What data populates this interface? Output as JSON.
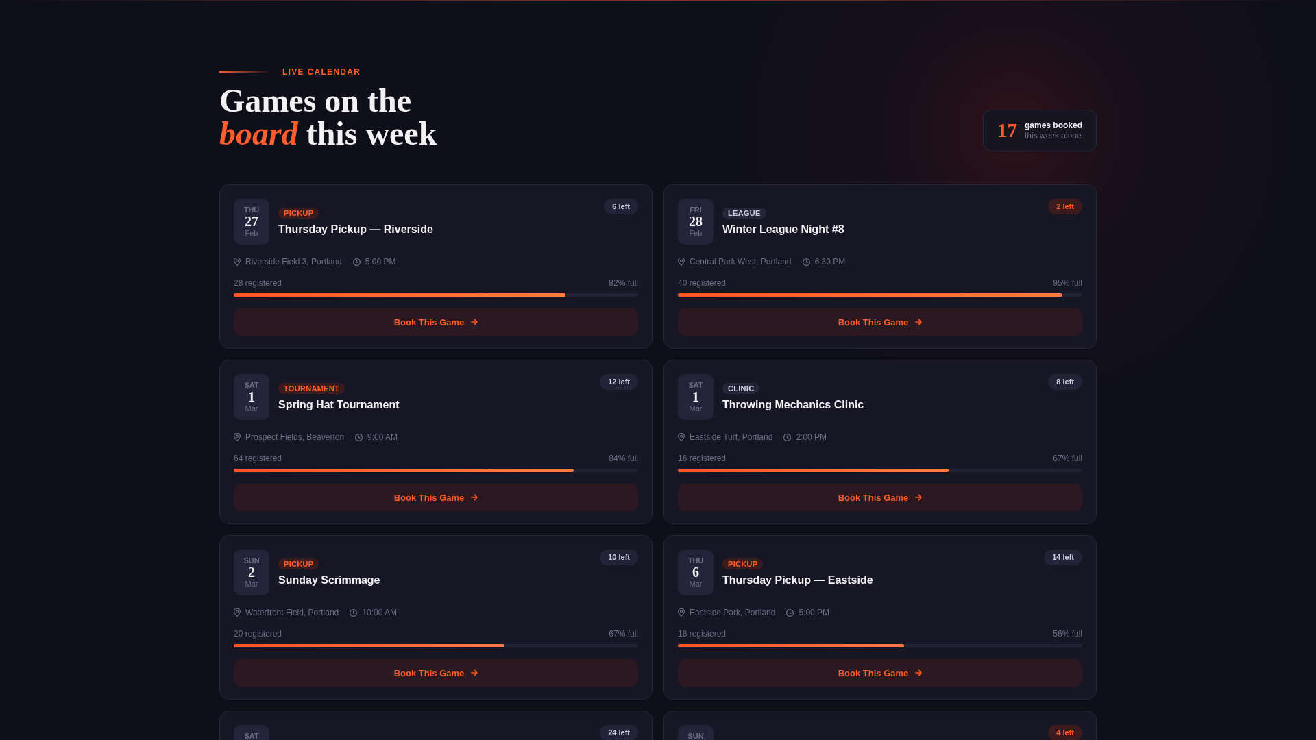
{
  "header": {
    "eyebrow": "LIVE CALENDAR",
    "heading": "Games on the *board* this week"
  },
  "stat": {
    "count": "17",
    "label": "games booked",
    "sublabel": "this week alone"
  },
  "games": [
    {
      "date": {
        "weekday": "THU",
        "day": "27",
        "month": "Feb"
      },
      "tag": {
        "label": "PICKUP",
        "kind": "accent"
      },
      "title": "Thursday Pickup — Riverside",
      "spots": {
        "label": "6 left",
        "urgent": false
      },
      "location": "Riverside Field 3, Portland",
      "time": "5:00 PM",
      "registered": "28 registered",
      "fill_label": "82% full",
      "level": 0.82,
      "action": "Book This Game"
    },
    {
      "date": {
        "weekday": "FRI",
        "day": "28",
        "month": "Feb"
      },
      "tag": {
        "label": "LEAGUE",
        "kind": "neutral"
      },
      "title": "Winter League Night #8",
      "spots": {
        "label": "2 left",
        "urgent": true
      },
      "location": "Central Park West, Portland",
      "time": "6:30 PM",
      "registered": "40 registered",
      "fill_label": "95% full",
      "level": 0.95,
      "action": "Book This Game"
    },
    {
      "date": {
        "weekday": "SAT",
        "day": "1",
        "month": "Mar"
      },
      "tag": {
        "label": "TOURNAMENT",
        "kind": "accent"
      },
      "title": "Spring Hat Tournament",
      "spots": {
        "label": "12 left",
        "urgent": false
      },
      "location": "Prospect Fields, Beaverton",
      "time": "9:00 AM",
      "registered": "64 registered",
      "fill_label": "84% full",
      "level": 0.84,
      "action": "Book This Game"
    },
    {
      "date": {
        "weekday": "SAT",
        "day": "1",
        "month": "Mar"
      },
      "tag": {
        "label": "CLINIC",
        "kind": "neutral"
      },
      "title": "Throwing Mechanics Clinic",
      "spots": {
        "label": "8 left",
        "urgent": false
      },
      "location": "Eastside Turf, Portland",
      "time": "2:00 PM",
      "registered": "16 registered",
      "fill_label": "67% full",
      "level": 0.67,
      "action": "Book This Game"
    },
    {
      "date": {
        "weekday": "SUN",
        "day": "2",
        "month": "Mar"
      },
      "tag": {
        "label": "PICKUP",
        "kind": "accent"
      },
      "title": "Sunday Scrimmage",
      "spots": {
        "label": "10 left",
        "urgent": false
      },
      "location": "Waterfront Field, Portland",
      "time": "10:00 AM",
      "registered": "20 registered",
      "fill_label": "67% full",
      "level": 0.67,
      "action": "Book This Game"
    },
    {
      "date": {
        "weekday": "THU",
        "day": "6",
        "month": "Mar"
      },
      "tag": {
        "label": "PICKUP",
        "kind": "accent"
      },
      "title": "Thursday Pickup — Eastside",
      "spots": {
        "label": "14 left",
        "urgent": false
      },
      "location": "Eastside Park, Portland",
      "time": "5:00 PM",
      "registered": "18 registered",
      "fill_label": "56% full",
      "level": 0.56,
      "action": "Book This Game"
    },
    {
      "date": {
        "weekday": "SAT"
      },
      "spots": {
        "label": "24 left",
        "urgent": false
      }
    },
    {
      "date": {
        "weekday": "SUN"
      },
      "spots": {
        "label": "4 left",
        "urgent": true
      }
    }
  ]
}
